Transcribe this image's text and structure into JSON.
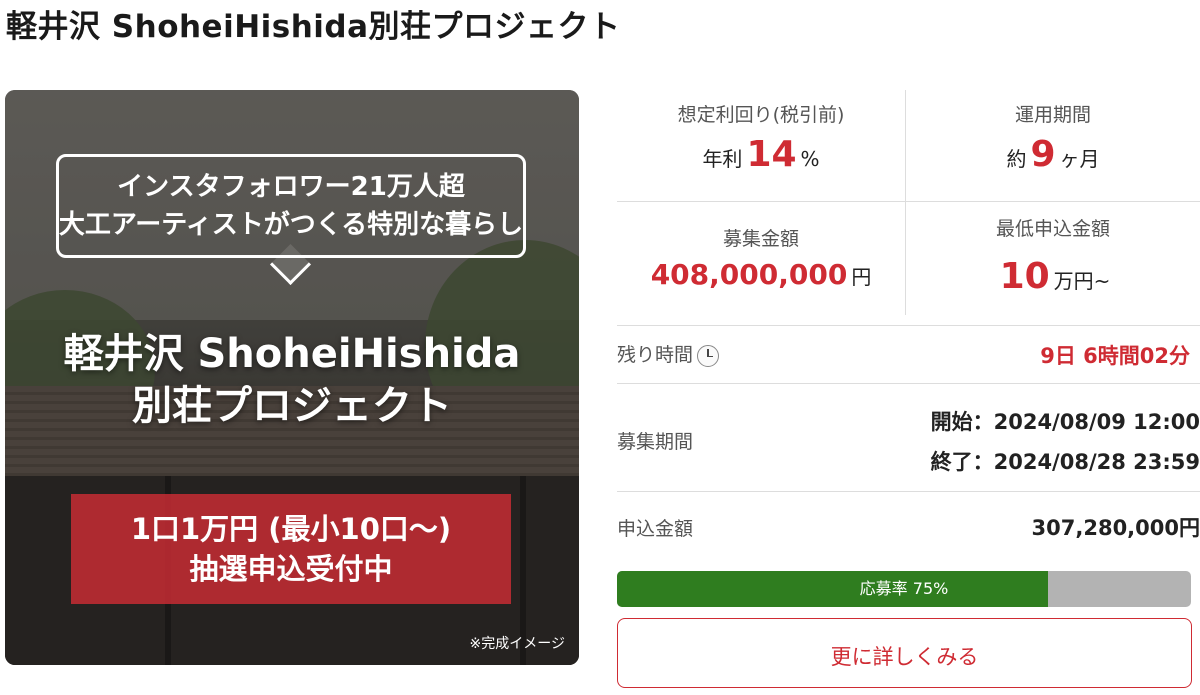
{
  "page": {
    "title": "軽井沢 ShoheiHishida別荘プロジェクト"
  },
  "hero": {
    "bubble_line1": "インスタフォロワー21万人超",
    "bubble_line2": "大工アーティストがつくる特別な暮らし",
    "title_line1": "軽井沢 ShoheiHishida",
    "title_line2": "別荘プロジェクト",
    "banner_line1": "1口1万円 (最小10口〜)",
    "banner_line2": "抽選申込受付中",
    "note": "※完成イメージ"
  },
  "stats": {
    "yield": {
      "label": "想定利回り(税引前)",
      "prefix": "年利",
      "value": "14",
      "unit": "%"
    },
    "period": {
      "label": "運用期間",
      "prefix": "約",
      "value": "9",
      "unit": "ヶ月"
    },
    "amount": {
      "label": "募集金額",
      "value": "408,000,000",
      "unit": "円"
    },
    "minimum": {
      "label": "最低申込金額",
      "value": "10",
      "unit": "万円~"
    }
  },
  "remaining": {
    "label": "残り時間",
    "value": "9日 6時間02分"
  },
  "recruitment": {
    "label": "募集期間",
    "start": "開始：2024/08/09 12:00",
    "end": "終了：2024/08/28 23:59"
  },
  "applied": {
    "label": "申込金額",
    "value": "307,280,000円"
  },
  "progress": {
    "text": "応募率 75%",
    "ratio": 0.75
  },
  "more_button": {
    "label": "更に詳しくみる"
  },
  "colors": {
    "accent": "#cf2b33",
    "progress": "#2f7d1f",
    "progress_track": "#b3b3b3"
  }
}
